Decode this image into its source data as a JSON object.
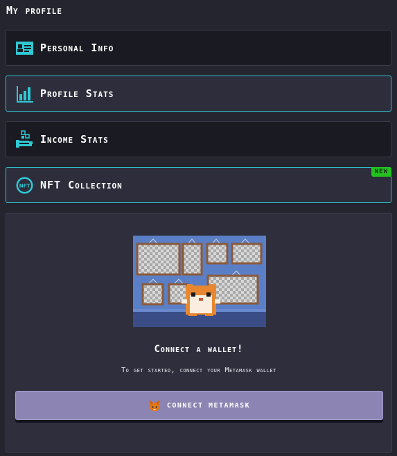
{
  "page": {
    "title": "My profile"
  },
  "menu": {
    "items": [
      {
        "label": "Personal Info",
        "icon": "id-card-icon"
      },
      {
        "label": "Profile Stats",
        "icon": "bar-chart-icon"
      },
      {
        "label": "Income Stats",
        "icon": "income-hand-coins-icon"
      },
      {
        "label": "NFT Collection",
        "icon": "nft-icon",
        "badge": "NEW"
      }
    ]
  },
  "wallet": {
    "illustration": "hamster-gallery-illustration",
    "title": "Connect a wallet!",
    "subtitle": "To get started, connect your Metamask wallet",
    "button_label": "CONNECT METAMASK",
    "button_icon": "metamask-fox-icon"
  },
  "colors": {
    "background": "#25252f",
    "accent": "#2ec9d3",
    "badge": "#22c21f",
    "button": "#8c84b2"
  }
}
